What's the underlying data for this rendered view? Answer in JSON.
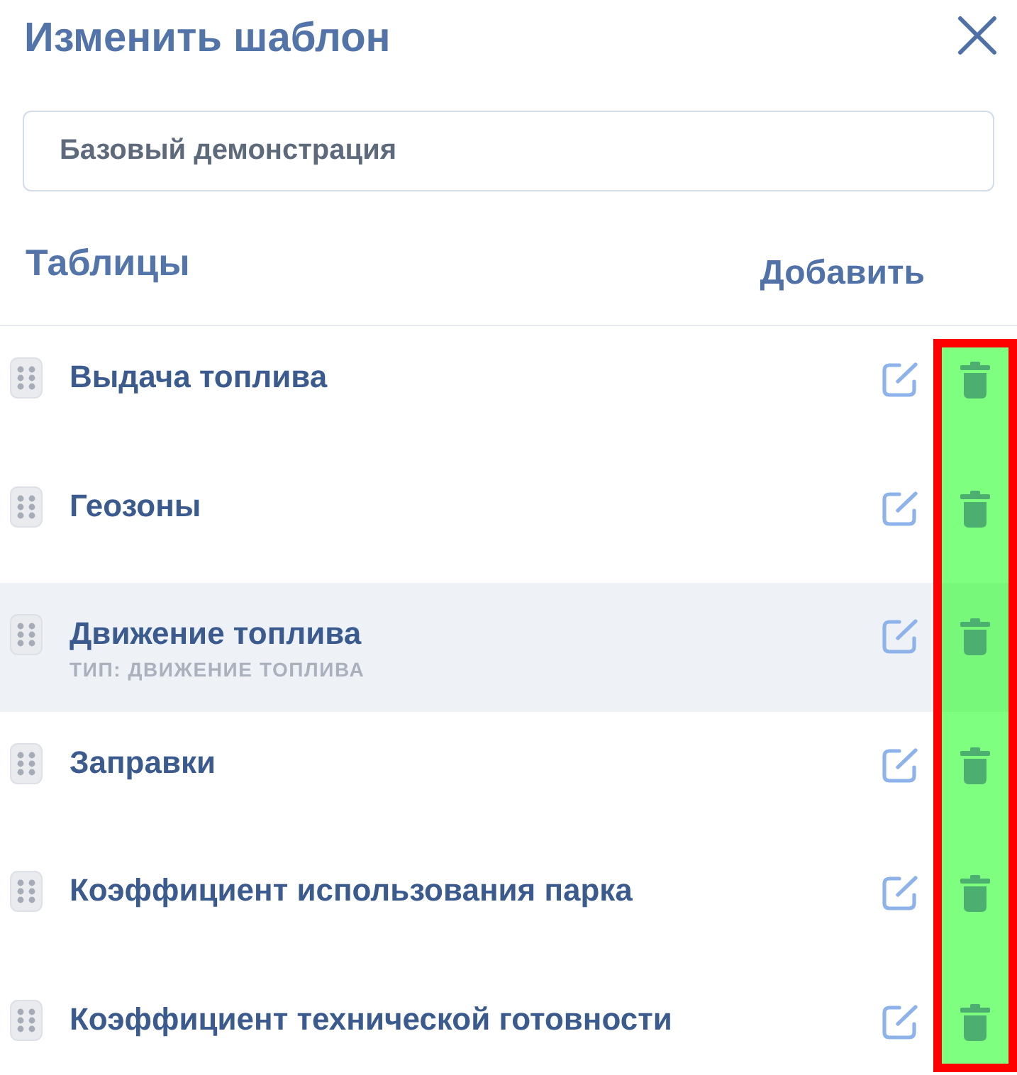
{
  "dialog": {
    "title": "Изменить шаблон"
  },
  "template_name": {
    "value": "Базовый демонстрация"
  },
  "section": {
    "title": "Таблицы",
    "add_button": "Добавить"
  },
  "tables": [
    {
      "name": "Выдача топлива",
      "selected": false
    },
    {
      "name": "Геозоны",
      "selected": false
    },
    {
      "name": "Движение топлива",
      "type_label": "ТИП: ДВИЖЕНИЕ ТОПЛИВА",
      "selected": true
    },
    {
      "name": "Заправки",
      "selected": false
    },
    {
      "name": "Коэффициент использования парка",
      "selected": false
    },
    {
      "name": "Коэффициент технической готовности",
      "selected": false
    }
  ],
  "annotation": {
    "kind": "highlight"
  }
}
